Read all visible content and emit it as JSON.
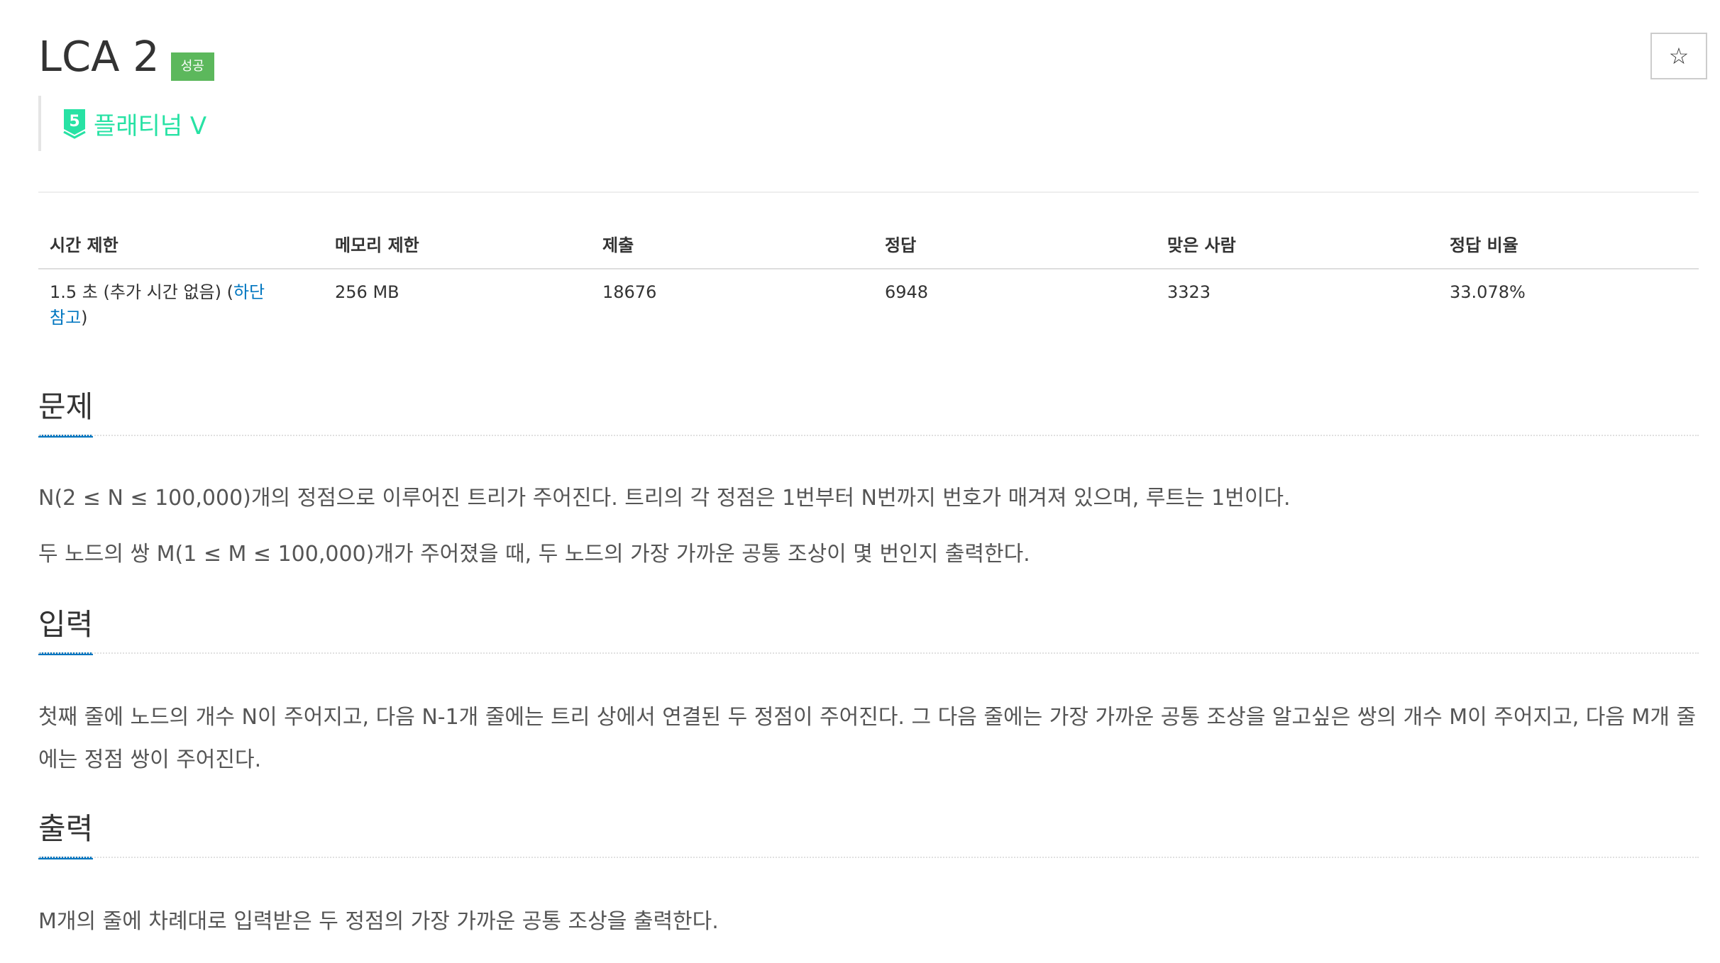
{
  "problem": {
    "title": "LCA 2",
    "status_badge": "성공",
    "star_icon": "☆",
    "tier_number": "5",
    "tier_label": "플래티넘 V"
  },
  "colors": {
    "success_badge": "#5cb85c",
    "tier": "#27e2a4",
    "link": "#0076c0",
    "section_underline": "#0076c0"
  },
  "info_table": {
    "headers": [
      "시간 제한",
      "메모리 제한",
      "제출",
      "정답",
      "맞은 사람",
      "정답 비율"
    ],
    "time_limit_text": "1.5 초 (추가 시간 없음) (",
    "time_limit_link": "하단 참고",
    "time_limit_close": ")",
    "memory_limit": "256 MB",
    "submissions": "18676",
    "accepted": "6948",
    "solvers": "3323",
    "ratio": "33.078%"
  },
  "sections": {
    "problem": {
      "heading": "문제",
      "paragraphs": [
        "N(2 ≤ N ≤ 100,000)개의 정점으로 이루어진 트리가 주어진다. 트리의 각 정점은 1번부터 N번까지 번호가 매겨져 있으며, 루트는 1번이다.",
        "두 노드의 쌍 M(1 ≤ M ≤ 100,000)개가 주어졌을 때, 두 노드의 가장 가까운 공통 조상이 몇 번인지 출력한다."
      ]
    },
    "input": {
      "heading": "입력",
      "text": "첫째 줄에 노드의 개수 N이 주어지고, 다음 N-1개 줄에는 트리 상에서 연결된 두 정점이 주어진다. 그 다음 줄에는 가장 가까운 공통 조상을 알고싶은 쌍의 개수 M이 주어지고, 다음 M개 줄에는 정점 쌍이 주어진다."
    },
    "output": {
      "heading": "출력",
      "text": "M개의 줄에 차례대로 입력받은 두 정점의 가장 가까운 공통 조상을 출력한다."
    }
  }
}
